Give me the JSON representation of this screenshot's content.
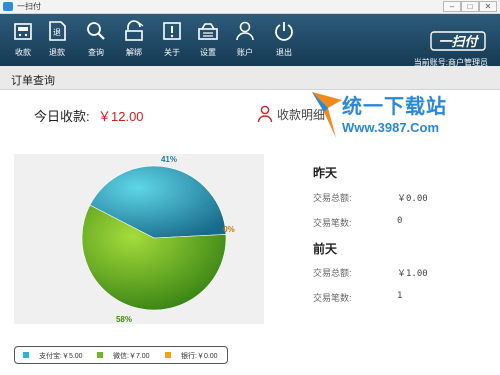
{
  "window": {
    "title": "一扫付"
  },
  "toolbar": {
    "items": [
      {
        "label": "收款",
        "icon": "cash-register-icon"
      },
      {
        "label": "退款",
        "icon": "refund-icon"
      },
      {
        "label": "查询",
        "icon": "search-icon"
      },
      {
        "label": "解绑",
        "icon": "unbind-icon"
      },
      {
        "label": "关于",
        "icon": "about-icon"
      },
      {
        "label": "设置",
        "icon": "settings-icon"
      },
      {
        "label": "账户",
        "icon": "user-icon"
      },
      {
        "label": "退出",
        "icon": "power-icon"
      }
    ],
    "brand": "一扫付",
    "account": "当前账号:商户管理员"
  },
  "page": {
    "title": "订单查询"
  },
  "summary": {
    "today_label": "今日收款:",
    "today_value": "￥12.00",
    "detail_link": "收款明细"
  },
  "watermark": {
    "title": "统一下载站",
    "url": "Www.3987.Com"
  },
  "chart_data": {
    "type": "pie",
    "series": [
      {
        "name": "支付宝",
        "value": 5.0,
        "percent": 41,
        "color": "#2bb5d0"
      },
      {
        "name": "微信",
        "value": 7.0,
        "percent": 58,
        "color": "#6cb82c"
      },
      {
        "name": "银行",
        "value": 0.0,
        "percent": 0,
        "color": "#f0a020"
      }
    ],
    "labels": [
      "41%",
      "58%",
      "0%"
    ],
    "legend": [
      "支付宝:￥5.00",
      "微信:￥7.00",
      "银行:￥0.00"
    ],
    "legend_position": "bottom"
  },
  "yesterday": {
    "title": "昨天",
    "total_label": "交易总额:",
    "total_value": "￥0.00",
    "count_label": "交易笔数:",
    "count_value": "0"
  },
  "day_before": {
    "title": "前天",
    "total_label": "交易总额:",
    "total_value": "￥1.00",
    "count_label": "交易笔数:",
    "count_value": "1"
  }
}
